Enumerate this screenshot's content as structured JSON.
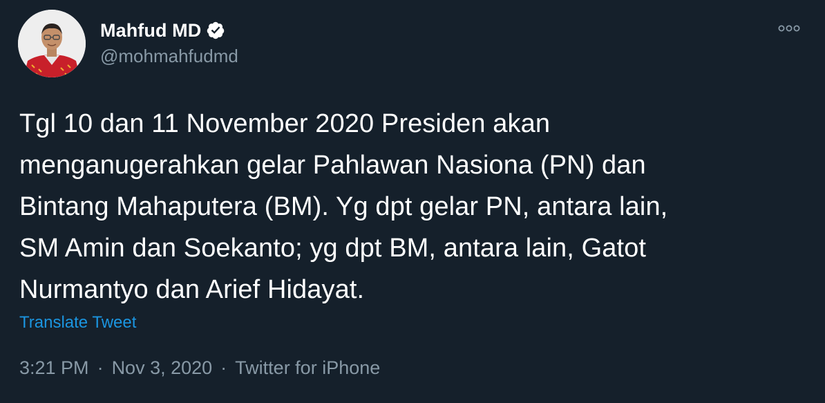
{
  "user": {
    "display_name": "Mahfud MD",
    "handle": "@mohmahfudmd",
    "verified": true
  },
  "tweet": {
    "text": "Tgl 10 dan 11 November 2020 Presiden akan\nmenganugerahkan gelar Pahlawan Nasiona (PN) dan\nBintang Mahaputera (BM). Yg dpt gelar PN, antara lain,\nSM Amin dan Soekanto; yg dpt BM, antara lain, Gatot\nNurmantyo dan Arief Hidayat.",
    "translate_label": "Translate Tweet",
    "time": "3:21 PM",
    "date": "Nov 3, 2020",
    "source": "Twitter for iPhone",
    "separator": "·"
  },
  "icons": {
    "verified": "verified-badge-icon",
    "more": "more-options-icon"
  },
  "colors": {
    "background": "#15202b",
    "primary_text": "#ffffff",
    "secondary_text": "#8899a6",
    "link": "#1b95e0"
  }
}
